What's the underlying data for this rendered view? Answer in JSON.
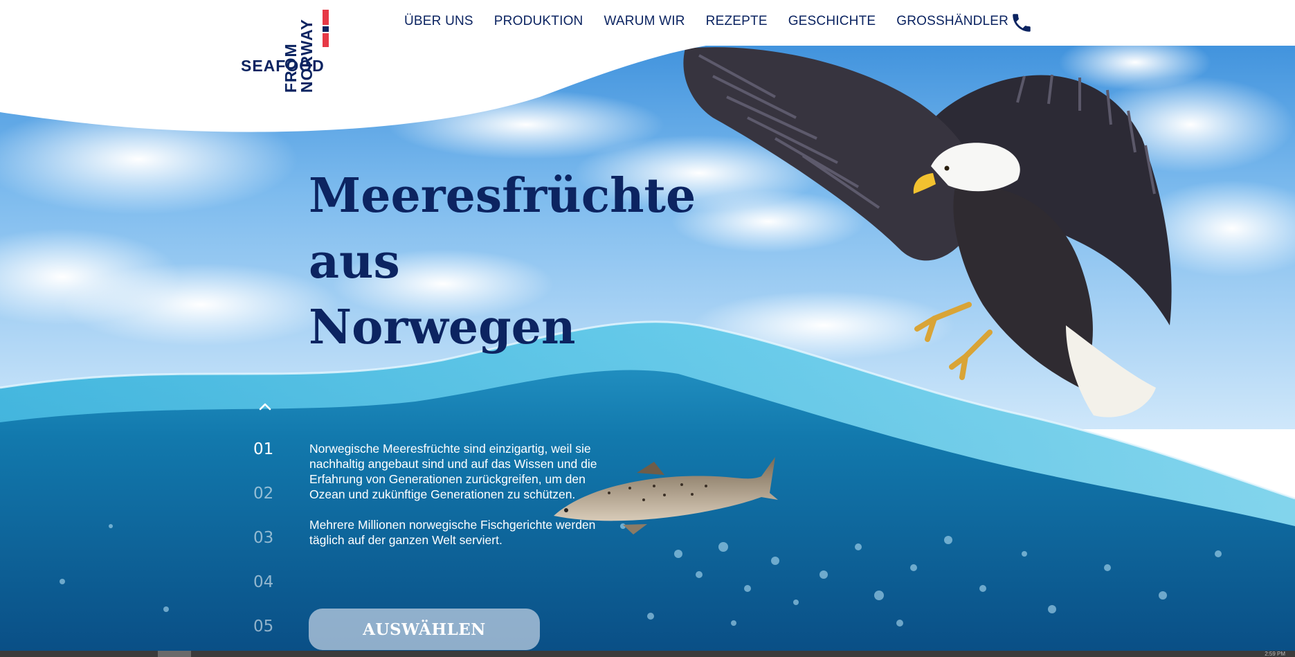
{
  "logo": {
    "line_seafood": "SEAFOOD",
    "line_from": "FROM",
    "line_norway": "NORWAY",
    "flag_colors": [
      "#e63946",
      "#ffffff",
      "#0c2461"
    ]
  },
  "nav": {
    "items": [
      {
        "label": "ÜBER UNS"
      },
      {
        "label": "PRODUKTION"
      },
      {
        "label": "WARUM WIR"
      },
      {
        "label": "REZEPTE"
      },
      {
        "label": "GESCHICHTE"
      },
      {
        "label": "GROSSHÄNDLER"
      }
    ],
    "phone_icon": "phone-icon"
  },
  "hero": {
    "headline": [
      "Meeresfrüchte",
      "aus",
      "Norwegen"
    ],
    "paragraphs": [
      "Norwegische Meeresfrüchte sind einzigartig, weil sie nachhaltig angebaut sind und auf das Wissen und die Erfahrung von Generationen zurückgreifen, um den Ozean und zukünftige Generationen zu schützen.",
      "Mehrere Millionen norwegische Fischgerichte werden täglich auf der ganzen Welt serviert."
    ],
    "cta_label": "AUSWÄHLEN",
    "up_icon": "chevron-up-icon"
  },
  "pager": {
    "items": [
      "01",
      "02",
      "03",
      "04",
      "05"
    ],
    "active_index": 0
  },
  "status_bar": {
    "clock": "2:59 PM"
  },
  "colors": {
    "brand_navy": "#0c2461",
    "flag_red": "#e63946",
    "sky": "#6fb0e6",
    "ocean": "#136a9e",
    "cta_fill": "#c4d2e4"
  }
}
